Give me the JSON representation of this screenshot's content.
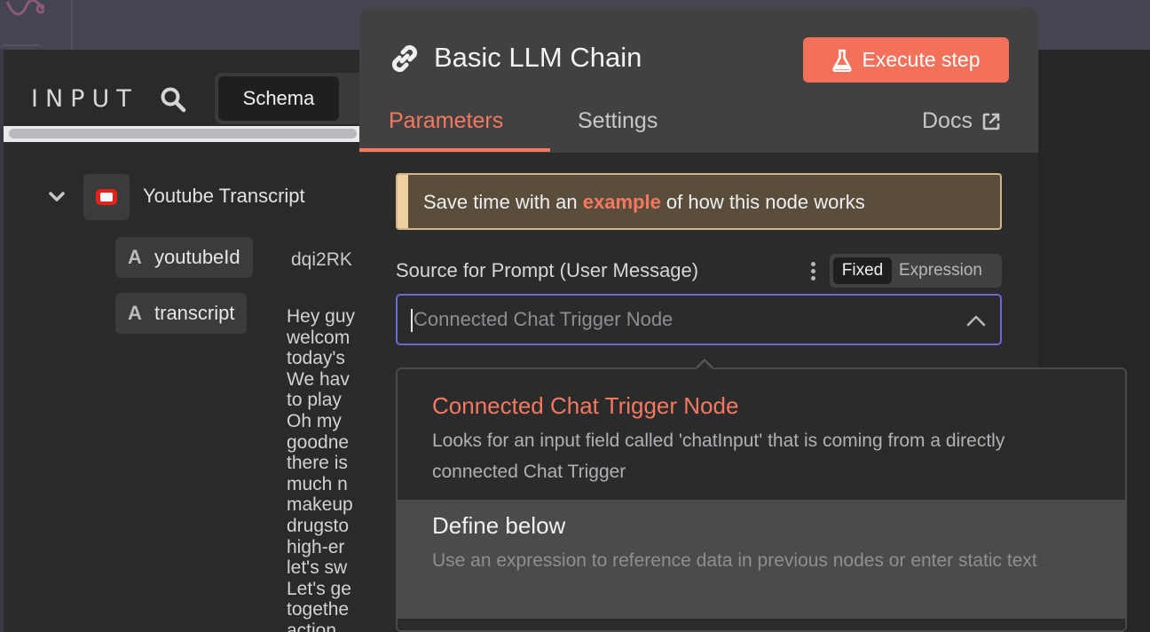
{
  "input_panel": {
    "title": "INPUT",
    "view_mode": "Schema",
    "node": {
      "name": "Youtube Transcript",
      "icon": "youtube-icon"
    },
    "fields": [
      {
        "type_icon": "A",
        "name": "youtubeId",
        "value": "dqi2RK"
      },
      {
        "type_icon": "A",
        "name": "transcript",
        "value_lines": "Hey guy\nwelcom\ntoday's\nWe hav\nto play\nOh my\ngoodne\nthere is\nmuch n\nmakeup\ndrugsto\nhigh-er\nlet's sw\nLet's ge\ntogethe\naction"
      }
    ]
  },
  "node_panel": {
    "title": "Basic LLM Chain",
    "execute_label": "Execute step",
    "tabs": [
      "Parameters",
      "Settings"
    ],
    "active_tab": "Parameters",
    "docs_label": "Docs",
    "notice": {
      "prefix": "Save time with an ",
      "link": "example",
      "suffix": " of how this node works"
    },
    "source_field": {
      "label": "Source for Prompt (User Message)",
      "mode_fixed": "Fixed",
      "mode_expression": "Expression",
      "active_mode": "Fixed",
      "placeholder": "Connected Chat Trigger Node"
    },
    "dropdown_options": [
      {
        "title": "Connected Chat Trigger Node",
        "description": "Looks for an input field called 'chatInput' that is coming from a directly connected Chat Trigger",
        "selected": true
      },
      {
        "title": "Define below",
        "description": "Use an expression to reference data in previous nodes or enter static text",
        "hovered": true
      }
    ]
  },
  "colors": {
    "accent": "#f57861",
    "execute_button": "#f3705a",
    "focus_border": "#6d6ad8",
    "notice_bg": "#5a4d3b",
    "notice_bar": "#f0d0a0",
    "youtube_red": "#e62117"
  }
}
